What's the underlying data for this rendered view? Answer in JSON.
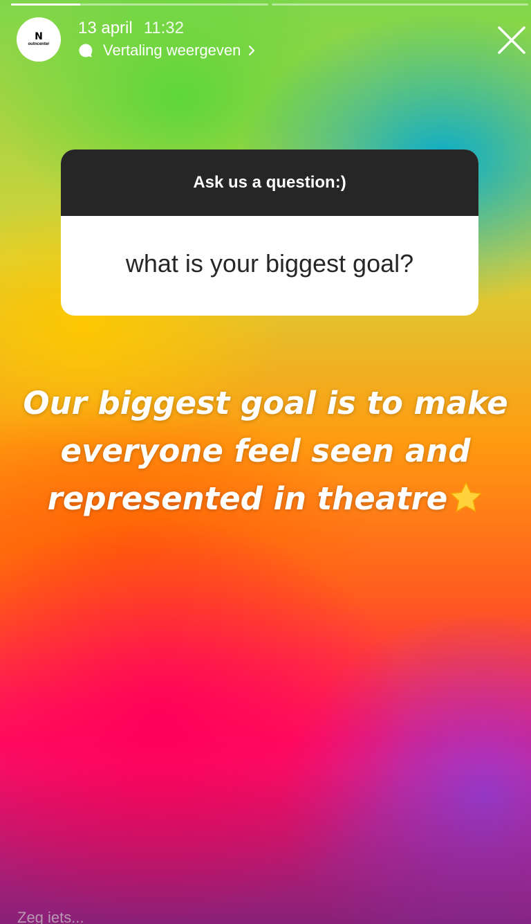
{
  "progress": {
    "segments": [
      0.27,
      0
    ]
  },
  "header": {
    "account_logo_mark": "N",
    "account_logo_name": "outncenter",
    "date": "13 april",
    "time": "11:32",
    "translate_label": "Vertaling weergeven"
  },
  "question_sticker": {
    "prompt": "Ask us a question:)",
    "question": "what is your biggest goal?"
  },
  "answer": {
    "line1": "Our biggest goal is to make",
    "line2": "everyone feel seen and",
    "line3": "represented in theatre"
  },
  "reply": {
    "placeholder": "Zeg iets..."
  },
  "icons": {
    "translate": "chat-bubble-icon",
    "chevron": "chevron-right-icon",
    "close": "close-icon",
    "star": "star-icon"
  },
  "colors": {
    "card_header": "#262626",
    "card_body": "#ffffff",
    "star": "#ffd23c"
  }
}
